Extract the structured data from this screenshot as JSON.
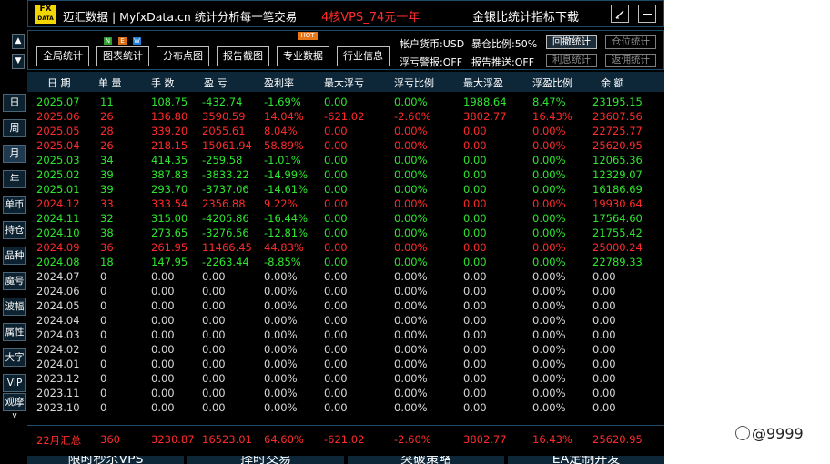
{
  "header": {
    "logo_top": "FX",
    "logo_bottom": "DATA",
    "brand": "迈汇数据 | MyfxData.cn  统计分析每一笔交易",
    "promo": "4核VPS_74元一年",
    "download": "金银比统计指标下载",
    "btn_edit_icon": "pencil-icon",
    "btn_min_icon": "minimize-icon"
  },
  "sidebar": {
    "arrows": [
      "▲",
      "▼"
    ],
    "items": [
      "日",
      "周",
      "月",
      "年",
      "单币",
      "持仓",
      "品种",
      "魔号",
      "波幅",
      "属性",
      "大字",
      "VIP",
      "观摩"
    ],
    "active_index": 2,
    "more": "v"
  },
  "toolbar": {
    "buttons": [
      "全局统计",
      "图表统计",
      "分布点图",
      "报告截图",
      "专业数据",
      "行业信息"
    ],
    "new_badge": [
      "N",
      "E",
      "W"
    ],
    "hot_badge": "HOT",
    "currency": "帐户货币:USD",
    "margin_ratio": "暴仓比例:50%",
    "float_alert": "浮亏警报:OFF",
    "report_push": "报告推送:OFF",
    "stat_buttons": [
      "回撤统计",
      "仓位统计",
      "利息统计",
      "返佣统计"
    ],
    "stat_active": 0
  },
  "table": {
    "headers": [
      "日 期",
      "单 量",
      "手 数",
      "盈 亏",
      "盈利率",
      "最大浮亏",
      "浮亏比例",
      "最大浮盈",
      "浮盈比例",
      "余 额"
    ],
    "rows": [
      {
        "c": "green",
        "v": [
          "2025.07",
          "11",
          "108.75",
          "-432.74",
          "-1.69%",
          "0.00",
          "0.00%",
          "1988.64",
          "8.47%",
          "23195.15"
        ]
      },
      {
        "c": "red",
        "v": [
          "2025.06",
          "26",
          "136.80",
          "3590.59",
          "14.04%",
          "-621.02",
          "-2.60%",
          "3802.77",
          "16.43%",
          "23607.56"
        ]
      },
      {
        "c": "red",
        "v": [
          "2025.05",
          "28",
          "339.20",
          "2055.61",
          "8.04%",
          "0.00",
          "0.00%",
          "0.00",
          "0.00%",
          "22725.77"
        ]
      },
      {
        "c": "red",
        "v": [
          "2025.04",
          "26",
          "218.15",
          "15061.94",
          "58.89%",
          "0.00",
          "0.00%",
          "0.00",
          "0.00%",
          "25620.95"
        ]
      },
      {
        "c": "green",
        "v": [
          "2025.03",
          "34",
          "414.35",
          "-259.58",
          "-1.01%",
          "0.00",
          "0.00%",
          "0.00",
          "0.00%",
          "12065.36"
        ]
      },
      {
        "c": "green",
        "v": [
          "2025.02",
          "39",
          "387.83",
          "-3833.22",
          "-14.99%",
          "0.00",
          "0.00%",
          "0.00",
          "0.00%",
          "12329.07"
        ]
      },
      {
        "c": "green",
        "v": [
          "2025.01",
          "39",
          "293.70",
          "-3737.06",
          "-14.61%",
          "0.00",
          "0.00%",
          "0.00",
          "0.00%",
          "16186.69"
        ]
      },
      {
        "c": "red",
        "v": [
          "2024.12",
          "33",
          "333.54",
          "2356.88",
          "9.22%",
          "0.00",
          "0.00%",
          "0.00",
          "0.00%",
          "19930.64"
        ]
      },
      {
        "c": "green",
        "v": [
          "2024.11",
          "32",
          "315.00",
          "-4205.86",
          "-16.44%",
          "0.00",
          "0.00%",
          "0.00",
          "0.00%",
          "17564.60"
        ]
      },
      {
        "c": "green",
        "v": [
          "2024.10",
          "38",
          "273.65",
          "-3276.56",
          "-12.81%",
          "0.00",
          "0.00%",
          "0.00",
          "0.00%",
          "21755.42"
        ]
      },
      {
        "c": "red",
        "v": [
          "2024.09",
          "36",
          "261.95",
          "11466.45",
          "44.83%",
          "0.00",
          "0.00%",
          "0.00",
          "0.00%",
          "25000.24"
        ]
      },
      {
        "c": "green",
        "v": [
          "2024.08",
          "18",
          "147.95",
          "-2263.44",
          "-8.85%",
          "0.00",
          "0.00%",
          "0.00",
          "0.00%",
          "22789.33"
        ]
      },
      {
        "c": "white",
        "v": [
          "2024.07",
          "0",
          "0.00",
          "0.00",
          "0.00%",
          "0.00",
          "0.00%",
          "0.00",
          "0.00%",
          "0.00"
        ]
      },
      {
        "c": "white",
        "v": [
          "2024.06",
          "0",
          "0.00",
          "0.00",
          "0.00%",
          "0.00",
          "0.00%",
          "0.00",
          "0.00%",
          "0.00"
        ]
      },
      {
        "c": "white",
        "v": [
          "2024.05",
          "0",
          "0.00",
          "0.00",
          "0.00%",
          "0.00",
          "0.00%",
          "0.00",
          "0.00%",
          "0.00"
        ]
      },
      {
        "c": "white",
        "v": [
          "2024.04",
          "0",
          "0.00",
          "0.00",
          "0.00%",
          "0.00",
          "0.00%",
          "0.00",
          "0.00%",
          "0.00"
        ]
      },
      {
        "c": "white",
        "v": [
          "2024.03",
          "0",
          "0.00",
          "0.00",
          "0.00%",
          "0.00",
          "0.00%",
          "0.00",
          "0.00%",
          "0.00"
        ]
      },
      {
        "c": "white",
        "v": [
          "2024.02",
          "0",
          "0.00",
          "0.00",
          "0.00%",
          "0.00",
          "0.00%",
          "0.00",
          "0.00%",
          "0.00"
        ]
      },
      {
        "c": "white",
        "v": [
          "2024.01",
          "0",
          "0.00",
          "0.00",
          "0.00%",
          "0.00",
          "0.00%",
          "0.00",
          "0.00%",
          "0.00"
        ]
      },
      {
        "c": "white",
        "v": [
          "2023.12",
          "0",
          "0.00",
          "0.00",
          "0.00%",
          "0.00",
          "0.00%",
          "0.00",
          "0.00%",
          "0.00"
        ]
      },
      {
        "c": "white",
        "v": [
          "2023.11",
          "0",
          "0.00",
          "0.00",
          "0.00%",
          "0.00",
          "0.00%",
          "0.00",
          "0.00%",
          "0.00"
        ]
      },
      {
        "c": "white",
        "v": [
          "2023.10",
          "0",
          "0.00",
          "0.00",
          "0.00%",
          "0.00",
          "0.00%",
          "0.00",
          "0.00%",
          "0.00"
        ]
      }
    ],
    "summary": [
      "22月汇总",
      "360",
      "3230.87",
      "16523.01",
      "64.60%",
      "-621.02",
      "-2.60%",
      "3802.77",
      "16.43%",
      "25620.95"
    ]
  },
  "bottom_tabs": [
    "限时秒杀VPS",
    "择时交易",
    "突破策略",
    "EA定制开发"
  ],
  "watermark": "@9999",
  "colors": {
    "profit": "#ff2b2b",
    "loss": "#2ee62e",
    "zero": "#d9d9d9",
    "header_bg": "#0d2739",
    "border": "#1d4b6a"
  }
}
